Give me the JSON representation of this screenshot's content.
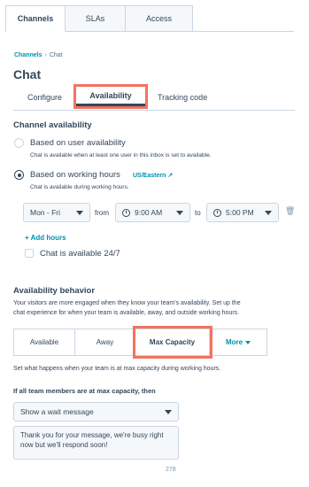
{
  "top_tabs": [
    "Channels",
    "SLAs",
    "Access"
  ],
  "breadcrumb": {
    "link": "Channels",
    "separator": "›",
    "current": "Chat"
  },
  "page_title": "Chat",
  "sub_tabs": [
    "Configure",
    "Availability",
    "Tracking code"
  ],
  "channel_availability": {
    "heading": "Channel availability",
    "option_user": {
      "label": "Based on user availability",
      "help": "Chat is available when at least one user in this inbox is set to available."
    },
    "option_hours": {
      "label": "Based on working hours",
      "help": "Chat is available during working hours.",
      "timezone": "US/Eastern"
    },
    "hours_row": {
      "days": "Mon - Fri",
      "from_label": "from",
      "from": "9:00 AM",
      "to_label": "to",
      "to": "5:00 PM"
    },
    "add_hours": "+ Add hours",
    "always_label": "Chat is available 24/7"
  },
  "availability_behavior": {
    "heading": "Availability behavior",
    "desc_line1": "Your visitors are more engaged when they know your team's availability. Set up the",
    "desc_line2": "chat experience for when your team is available, away, and outside working hours.",
    "tabs": [
      "Available",
      "Away",
      "Max Capacity",
      "More"
    ],
    "cap_desc": "Set what happens when your team is at max capacity during working hours.",
    "cap_question": "If all team members are at max capacity, then",
    "cap_select": "Show a wait message",
    "wait_message": "Thank you for your message, we're busy right now but we'll respond soon!"
  },
  "page_number": "278",
  "colors": {
    "accent": "#0091ae",
    "highlight": "#f2735f",
    "text": "#33475b",
    "border": "#cbd6e2"
  }
}
